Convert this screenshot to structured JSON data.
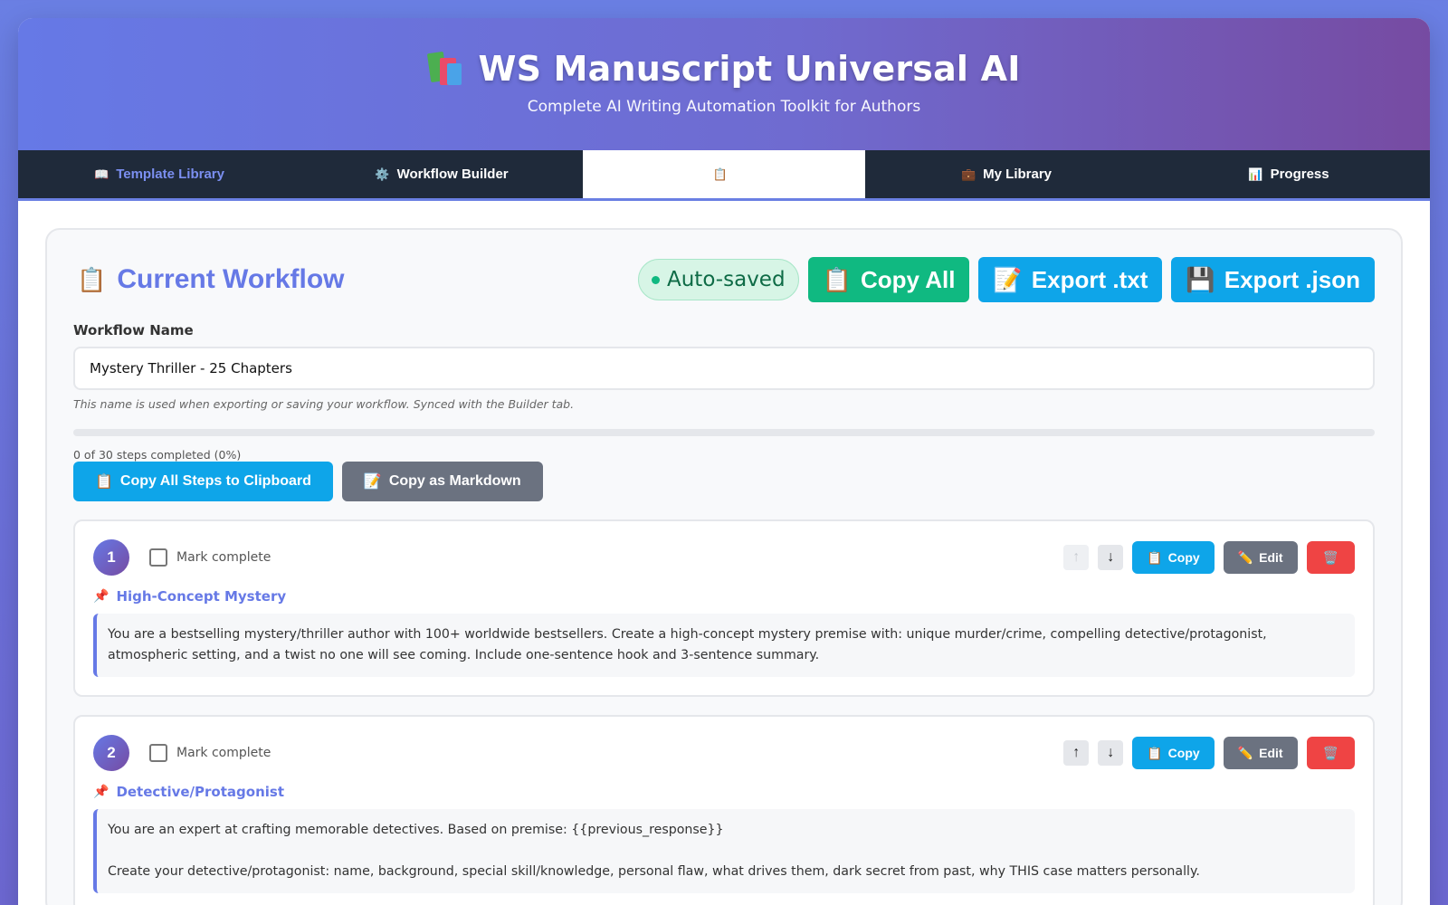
{
  "app": {
    "title": "WS Manuscript Universal AI",
    "subtitle": "Complete AI Writing Automation Toolkit for Authors",
    "logo_icon": "books-icon"
  },
  "tabs": [
    {
      "label": "Template Library",
      "icon": "📖"
    },
    {
      "label": "Workflow Builder",
      "icon": "⚙️"
    },
    {
      "label": "",
      "icon": "📋",
      "active": true
    },
    {
      "label": "My Library",
      "icon": "💼"
    },
    {
      "label": "Progress",
      "icon": "📊"
    }
  ],
  "panel": {
    "title": "Current Workflow",
    "title_icon": "📋",
    "autosave_label": "Auto-saved",
    "copy_all_label": "Copy All",
    "export_txt_label": "Export .txt",
    "export_json_label": "Export .json"
  },
  "workflow": {
    "name_label": "Workflow Name",
    "name_value": "Mystery Thriller - 25 Chapters",
    "hint": "This name is used when exporting or saving your workflow. Synced with the Builder tab.",
    "progress_text": "0 of 30 steps completed (0%)",
    "progress_fraction": 0,
    "copy_steps_label": "Copy All Steps to Clipboard",
    "copy_markdown_label": "Copy as Markdown"
  },
  "step_ui": {
    "mark_complete": "Mark complete",
    "up": "↑",
    "down": "↓",
    "copy": "Copy",
    "edit": "Edit",
    "delete_icon": "trash-icon"
  },
  "steps": [
    {
      "number": "1",
      "title": "High-Concept Mystery",
      "prompt": "You are a bestselling mystery/thriller author with 100+ worldwide bestsellers. Create a high-concept mystery premise with: unique murder/crime, compelling detective/protagonist, atmospheric setting, and a twist no one will see coming. Include one-sentence hook and 3-sentence summary."
    },
    {
      "number": "2",
      "title": "Detective/Protagonist",
      "prompt": "You are an expert at crafting memorable detectives. Based on premise: {{previous_response}}\n\nCreate your detective/protagonist: name, background, special skill/knowledge, personal flaw, what drives them, dark secret from past, why THIS case matters personally."
    }
  ],
  "colors": {
    "accent": "#6679e6",
    "green": "#10b981",
    "blue": "#0ea5e9",
    "gray": "#6b7280",
    "red": "#ef4444",
    "tabbar": "#1f2a3a"
  }
}
